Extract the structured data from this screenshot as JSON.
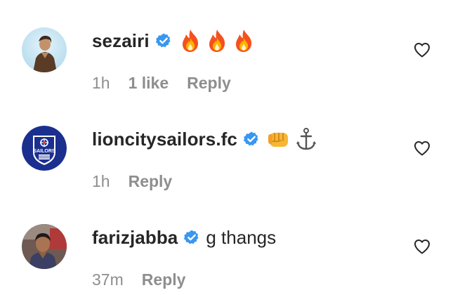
{
  "comments": [
    {
      "username": "sezairi",
      "verified": true,
      "text": "",
      "emojis": [
        "fire-emoji",
        "fire-emoji",
        "fire-emoji"
      ],
      "time": "1h",
      "likes": "1 like",
      "reply": "Reply",
      "avatar_icon": "sezairi-avatar"
    },
    {
      "username": "lioncitysailors.fc",
      "verified": true,
      "text": "",
      "emojis": [
        "oncoming-fist-emoji",
        "anchor-emoji"
      ],
      "time": "1h",
      "likes": "",
      "reply": "Reply",
      "avatar_icon": "lion-city-sailors-logo",
      "logo_text": "SAILORS"
    },
    {
      "username": "farizjabba",
      "verified": true,
      "text": "g thangs",
      "emojis": [],
      "time": "37m",
      "likes": "",
      "reply": "Reply",
      "avatar_icon": "farizjabba-avatar"
    }
  ],
  "colors": {
    "verified_blue": "#3897f0",
    "meta_gray": "#8e8e8e",
    "text": "#262626",
    "sailors_navy": "#1b2f8f"
  }
}
